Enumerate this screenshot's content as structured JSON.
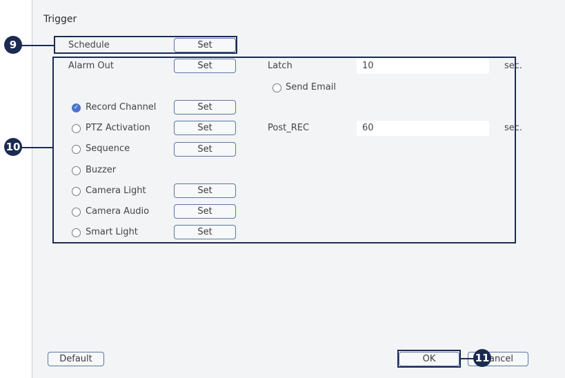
{
  "window": {
    "title": "Trigger"
  },
  "schedule": {
    "label": "Schedule",
    "button": "Set"
  },
  "alarm_out": {
    "label": "Alarm Out",
    "button": "Set"
  },
  "latch": {
    "label": "Latch",
    "value": "10",
    "unit": "sec."
  },
  "send_email": {
    "label": "Send Email",
    "checked": false
  },
  "record_channel": {
    "label": "Record Channel",
    "checked": true,
    "button": "Set"
  },
  "ptz_activation": {
    "label": "PTZ Activation",
    "checked": false,
    "button": "Set"
  },
  "post_rec": {
    "label": "Post_REC",
    "value": "60",
    "unit": "sec."
  },
  "sequence": {
    "label": "Sequence",
    "checked": false,
    "button": "Set"
  },
  "buzzer": {
    "label": "Buzzer",
    "checked": false
  },
  "camera_light": {
    "label": "Camera Light",
    "checked": false,
    "button": "Set"
  },
  "camera_audio": {
    "label": "Camera Audio",
    "checked": false,
    "button": "Set"
  },
  "smart_light": {
    "label": "Smart Light",
    "checked": false,
    "button": "Set"
  },
  "footer": {
    "default_label": "Default",
    "ok_label": "OK",
    "cancel_label": "Cancel"
  },
  "callouts": [
    "9",
    "10",
    "11"
  ],
  "colors": {
    "accent": "#4a74c9",
    "highlight": "#1a2a52",
    "button_border": "#5876a3"
  }
}
